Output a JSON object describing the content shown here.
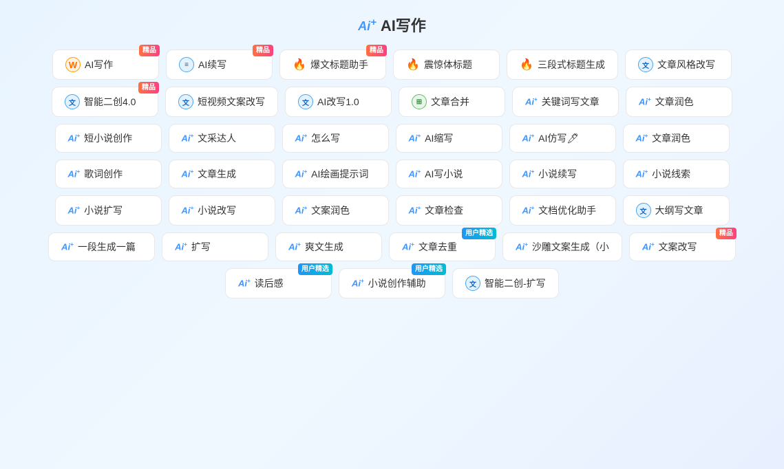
{
  "page": {
    "title": "AI写作",
    "logo": "Ai+"
  },
  "rows": [
    [
      {
        "id": "ai-writing",
        "icon": "circle-w",
        "iconType": "orange",
        "label": "AI写作",
        "badge": "精品",
        "badgeType": "jingpin"
      },
      {
        "id": "ai-continue",
        "icon": "list",
        "iconType": "blue",
        "label": "AI续写",
        "badge": "精品",
        "badgeType": "jingpin"
      },
      {
        "id": "explode-title",
        "icon": "flame",
        "iconType": "pink",
        "label": "爆文标题助手",
        "badge": "精品",
        "badgeType": "jingpin"
      },
      {
        "id": "shock-title",
        "icon": "flame2",
        "iconType": "pink",
        "label": "震惊体标题",
        "badge": "",
        "badgeType": ""
      },
      {
        "id": "three-title",
        "icon": "flame3",
        "iconType": "pink",
        "label": "三段式标题生成",
        "badge": "",
        "badgeType": ""
      },
      {
        "id": "article-style",
        "icon": "doc",
        "iconType": "doc",
        "label": "文章风格改写",
        "badge": "",
        "badgeType": ""
      }
    ],
    [
      {
        "id": "smart-create",
        "icon": "doc2",
        "iconType": "doc",
        "label": "智能二创4.0",
        "badge": "精品",
        "badgeType": "jingpin"
      },
      {
        "id": "short-video",
        "icon": "doc3",
        "iconType": "doc",
        "label": "短视频文案改写",
        "badge": "",
        "badgeType": ""
      },
      {
        "id": "ai-rewrite",
        "icon": "doc4",
        "iconType": "doc",
        "label": "AI改写1.0",
        "badge": "",
        "badgeType": ""
      },
      {
        "id": "article-merge",
        "icon": "grid",
        "iconType": "grid",
        "label": "文章合并",
        "badge": "",
        "badgeType": ""
      },
      {
        "id": "keyword-article",
        "icon": "ai",
        "iconType": "ai",
        "label": "关键词写文章",
        "badge": "",
        "badgeType": ""
      },
      {
        "id": "article-polish",
        "icon": "ai",
        "iconType": "ai",
        "label": "文章润色",
        "badge": "",
        "badgeType": ""
      }
    ],
    [
      {
        "id": "short-novel",
        "icon": "ai",
        "iconType": "ai",
        "label": "短小说创作",
        "badge": "",
        "badgeType": ""
      },
      {
        "id": "literary",
        "icon": "ai",
        "iconType": "ai",
        "label": "文采达人",
        "badge": "",
        "badgeType": ""
      },
      {
        "id": "how-write",
        "icon": "ai",
        "iconType": "ai",
        "label": "怎么写",
        "badge": "",
        "badgeType": ""
      },
      {
        "id": "ai-summary",
        "icon": "ai",
        "iconType": "ai",
        "label": "AI缩写",
        "badge": "",
        "badgeType": ""
      },
      {
        "id": "ai-imitate",
        "icon": "ai",
        "iconType": "ai",
        "label": "AI仿写🖊",
        "badge": "",
        "badgeType": ""
      },
      {
        "id": "article-polish2",
        "icon": "ai",
        "iconType": "ai",
        "label": "文章润色",
        "badge": "",
        "badgeType": ""
      }
    ],
    [
      {
        "id": "lyric",
        "icon": "ai",
        "iconType": "ai",
        "label": "歌词创作",
        "badge": "",
        "badgeType": ""
      },
      {
        "id": "article-gen",
        "icon": "ai",
        "iconType": "ai",
        "label": "文章生成",
        "badge": "",
        "badgeType": ""
      },
      {
        "id": "ai-draw-prompt",
        "icon": "ai",
        "iconType": "ai",
        "label": "AI绘画提示词",
        "badge": "",
        "badgeType": ""
      },
      {
        "id": "ai-novel-write",
        "icon": "ai",
        "iconType": "ai",
        "label": "AI写小说",
        "badge": "",
        "badgeType": ""
      },
      {
        "id": "novel-continue",
        "icon": "ai",
        "iconType": "ai",
        "label": "小说续写",
        "badge": "",
        "badgeType": ""
      },
      {
        "id": "novel-clue",
        "icon": "ai",
        "iconType": "ai",
        "label": "小说线索",
        "badge": "",
        "badgeType": ""
      }
    ],
    [
      {
        "id": "novel-expand",
        "icon": "ai",
        "iconType": "ai",
        "label": "小说扩写",
        "badge": "",
        "badgeType": ""
      },
      {
        "id": "novel-rewrite",
        "icon": "ai",
        "iconType": "ai",
        "label": "小说改写",
        "badge": "",
        "badgeType": ""
      },
      {
        "id": "copy-polish",
        "icon": "ai",
        "iconType": "ai",
        "label": "文案润色",
        "badge": "",
        "badgeType": ""
      },
      {
        "id": "article-check",
        "icon": "ai",
        "iconType": "ai",
        "label": "文章检查",
        "badge": "",
        "badgeType": ""
      },
      {
        "id": "doc-optimize",
        "icon": "ai",
        "iconType": "ai",
        "label": "文档优化助手",
        "badge": "",
        "badgeType": ""
      },
      {
        "id": "outline-write",
        "icon": "doc5",
        "iconType": "doc",
        "label": "大纲写文章",
        "badge": "",
        "badgeType": ""
      }
    ],
    [
      {
        "id": "one-para",
        "icon": "ai",
        "iconType": "ai",
        "label": "一段生成一篇",
        "badge": "",
        "badgeType": ""
      },
      {
        "id": "expand",
        "icon": "ai",
        "iconType": "ai",
        "label": "扩写",
        "badge": "",
        "badgeType": ""
      },
      {
        "id": "fun-gen",
        "icon": "ai",
        "iconType": "ai",
        "label": "爽文生成",
        "badge": "",
        "badgeType": ""
      },
      {
        "id": "article-dedup",
        "icon": "ai",
        "iconType": "ai",
        "label": "文章去重",
        "badge": "用户精选",
        "badgeType": "user"
      },
      {
        "id": "sand-copy",
        "icon": "ai",
        "iconType": "ai",
        "label": "沙雕文案生成（小",
        "badge": "",
        "badgeType": ""
      },
      {
        "id": "copy-rewrite",
        "icon": "ai",
        "iconType": "ai",
        "label": "文案改写",
        "badge": "精品",
        "badgeType": "jingpin"
      }
    ],
    [
      {
        "id": "read-feel",
        "icon": "ai",
        "iconType": "ai",
        "label": "读后感",
        "badge": "用户精选",
        "badgeType": "user"
      },
      {
        "id": "novel-assist",
        "icon": "ai",
        "iconType": "ai",
        "label": "小说创作辅助",
        "badge": "用户精选",
        "badgeType": "user"
      },
      {
        "id": "smart-create2",
        "icon": "doc6",
        "iconType": "doc",
        "label": "智能二创-扩写",
        "badge": "",
        "badgeType": ""
      }
    ]
  ]
}
